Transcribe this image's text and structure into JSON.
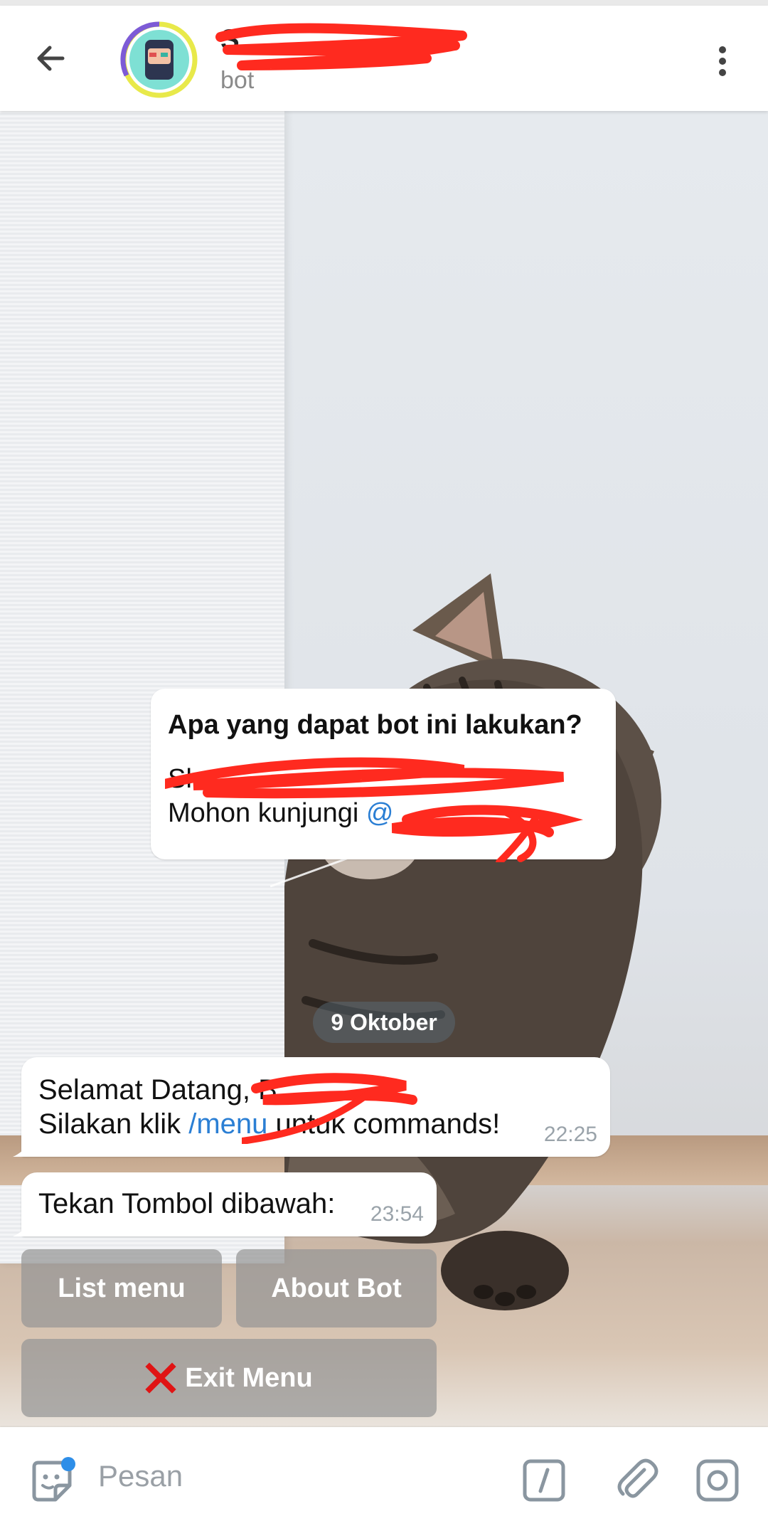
{
  "header": {
    "back_icon": "arrow-left-icon",
    "title": "S",
    "subtitle": "bot",
    "more_icon": "vertical-dots-icon"
  },
  "info_card": {
    "heading": "Apa yang dapat bot ini lakukan?",
    "line1": "Sh",
    "line2_prefix": "Mohon kunjungi ",
    "line2_link": "@"
  },
  "date_separator": "9 Oktober",
  "messages": [
    {
      "line1": "Selamat Datang, B",
      "line2_prefix": "Silakan klik ",
      "line2_link": "/menu",
      "line2_suffix": " untuk commands!",
      "time": "22:25"
    },
    {
      "line1": "Tekan Tombol dibawah:",
      "time": "23:54"
    }
  ],
  "keyboard": {
    "list_menu": "List menu",
    "about_bot": "About Bot",
    "exit_menu": "Exit Menu",
    "exit_icon": "red-x-icon"
  },
  "composer": {
    "placeholder": "Pesan",
    "sticker_icon": "sticker-icon",
    "command_icon": "slash-command-icon",
    "attach_icon": "paperclip-icon",
    "camera_icon": "camera-icon"
  },
  "colors": {
    "accent": "#2b7fd4",
    "redaction": "#ff2a1f",
    "exit_x": "#e01414"
  }
}
